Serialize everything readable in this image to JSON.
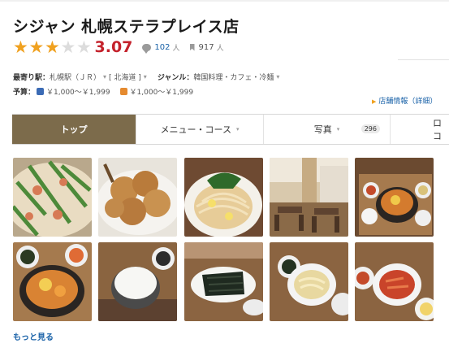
{
  "shop": {
    "name": "シジャン 札幌ステラプレイス店"
  },
  "rating": {
    "score": "3.07",
    "stars_filled": 3,
    "stars_total": 5,
    "reviews": "102",
    "reviews_unit": "人",
    "saves": "917",
    "saves_unit": "人"
  },
  "info": {
    "station_label": "最寄り駅：",
    "station_value": "札幌駅（ＪＲ）",
    "area_value": "[ 北海道 ]",
    "genre_label": "ジャンル：",
    "genre_value": "韓国料理・カフェ・冷麺",
    "budget_label": "予算：",
    "budget_dinner": "￥1,000～￥1,999",
    "budget_lunch": "￥1,000～￥1,999",
    "detail_link": "店舗情報（詳細）"
  },
  "tabs": [
    {
      "label": "トップ"
    },
    {
      "label": "メニュー・コース"
    },
    {
      "label": "写真",
      "count": "296"
    },
    {
      "label": "ロコ"
    }
  ],
  "photos": [
    "seafood-pancake",
    "fried-chicken",
    "cold-noodles",
    "restaurant-interior",
    "stew-set-tray",
    "stew-pot",
    "rice-bowl",
    "seaweed-plate",
    "banchan-sprouts",
    "banchan-kimchi"
  ],
  "colors": {
    "star": "#f0a11f",
    "score": "#c4212b",
    "link": "#1a62a8",
    "active_tab": "#7c6b4b"
  },
  "more_link": "もっと見る"
}
